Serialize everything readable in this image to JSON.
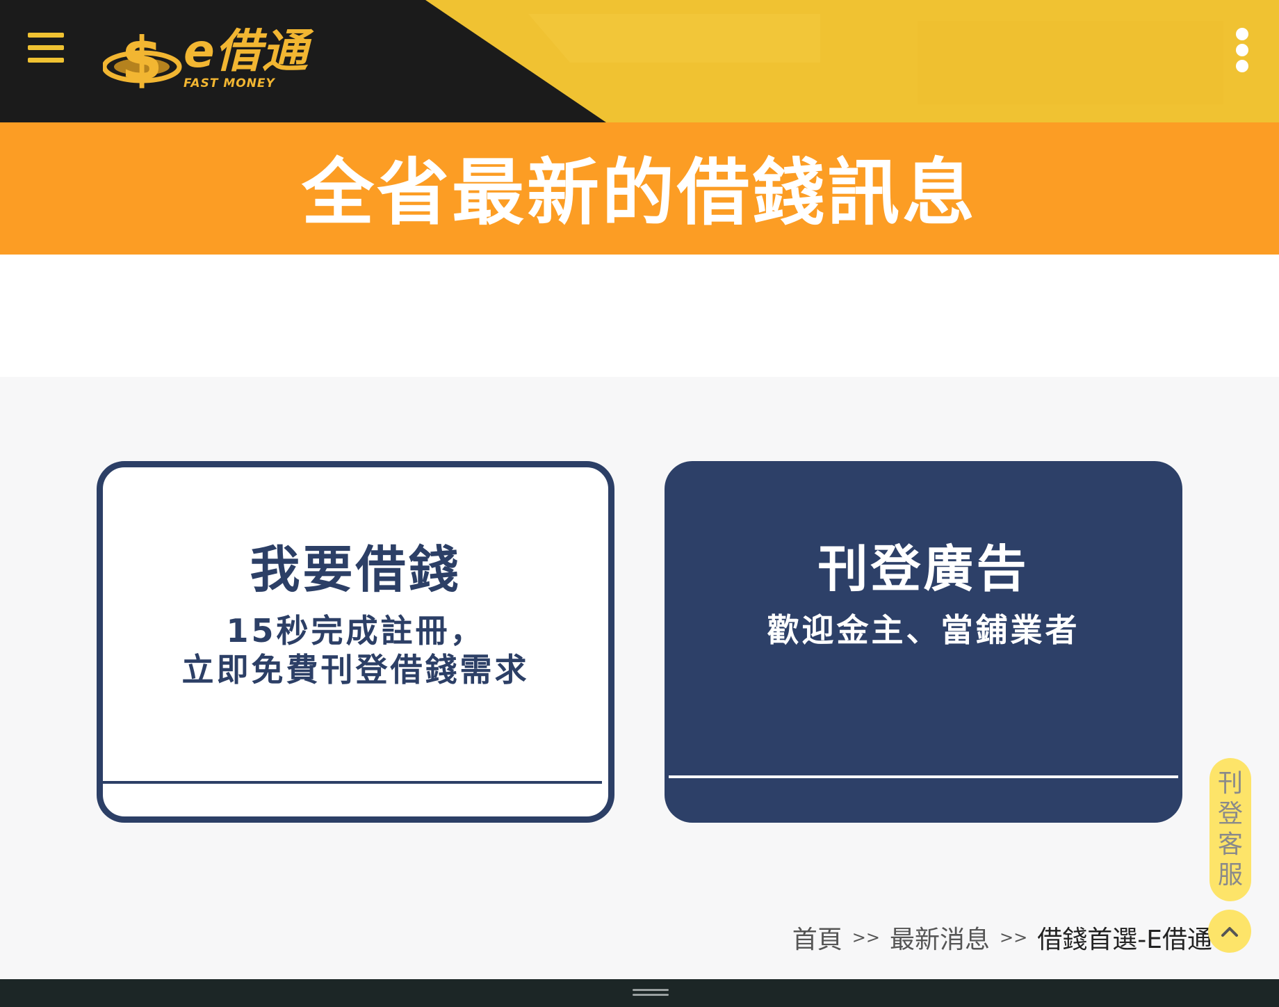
{
  "header": {
    "menu_icon": "hamburger-menu-icon",
    "logo": {
      "brand": "e借通",
      "tagline": "FAST MONEY",
      "icon": "dollar-coin-icon"
    },
    "more_icon": "kebab-menu-icon",
    "colors": {
      "dark": "#1b1b1b",
      "yellow": "#f0c232",
      "logo_gold": "#f2b632"
    }
  },
  "banner": {
    "title": "全省最新的借錢訊息",
    "color": "#fc9d24"
  },
  "cards": [
    {
      "title": "我要借錢",
      "subtitle_line1": "15秒完成註冊，",
      "subtitle_line2": "立即免費刊登借錢需求"
    },
    {
      "title": "刊登廣告",
      "subtitle_line1": "歡迎金主、當鋪業者"
    }
  ],
  "floating": {
    "service_chars": [
      "刊",
      "登",
      "客",
      "服"
    ],
    "back_to_top_icon": "chevron-up-icon"
  },
  "breadcrumb": {
    "home": "首頁",
    "sep": ">>",
    "news": "最新消息",
    "current": "借錢首選-E借通"
  },
  "theme": {
    "navy": "#2c3f66",
    "light_yellow": "#fde469"
  }
}
